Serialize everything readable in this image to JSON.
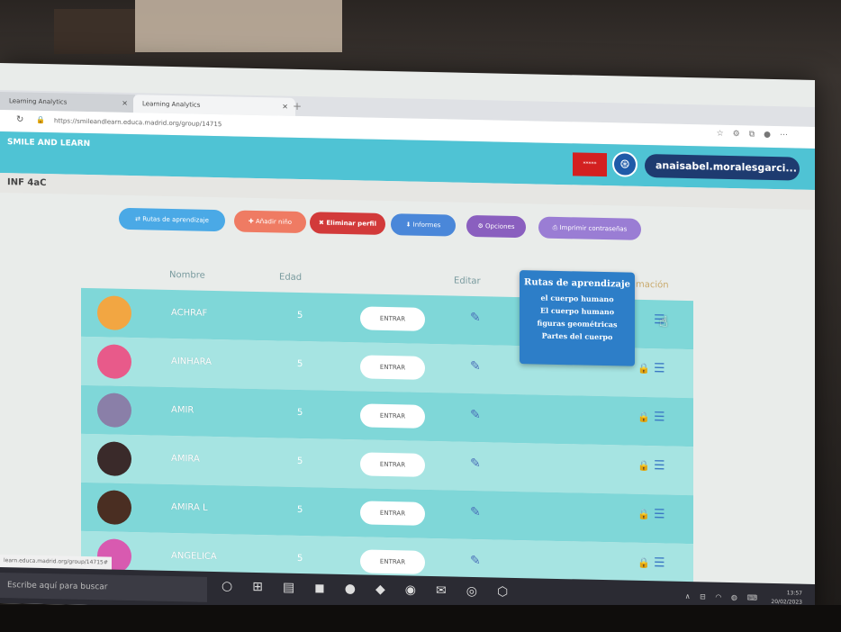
{
  "browser": {
    "tabs": [
      {
        "label": "Learning Analytics",
        "close": "×"
      },
      {
        "label": "Learning Analytics",
        "close": "×"
      }
    ],
    "new_tab": "+",
    "url": "https://smileandlearn.educa.madrid.org/group/14715",
    "status_url": "learn.educa.madrid.org/group/14715#"
  },
  "header": {
    "logo": "SMILE AND LEARN",
    "user": "anaisabel.moralesgarci...",
    "flag_label": "*****"
  },
  "breadcrumb": "INF 4aC",
  "actions": [
    {
      "label": "Rutas de aprendizaje",
      "icon": "route-icon"
    },
    {
      "label": "Añadir niño",
      "icon": "add-child-icon"
    },
    {
      "label": "Eliminar perfil",
      "icon": "close-icon"
    },
    {
      "label": "Informes",
      "icon": "download-icon"
    },
    {
      "label": "Opciones",
      "icon": "gear-icon"
    },
    {
      "label": "Imprimir contraseñas",
      "icon": "print-icon"
    }
  ],
  "table": {
    "headers": {
      "nombre": "Nombre",
      "edad": "Edad",
      "editar": "Editar",
      "info": "mación"
    },
    "enter_label": "ENTRAR",
    "rows": [
      {
        "name": "ACHRAF",
        "age": "5",
        "avatar_color": "#f2a642"
      },
      {
        "name": "AINHARA",
        "age": "5",
        "avatar_color": "#e85a8a"
      },
      {
        "name": "AMIR",
        "age": "5",
        "avatar_color": "#8a7fa8"
      },
      {
        "name": "AMIRA",
        "age": "5",
        "avatar_color": "#3a2a2a"
      },
      {
        "name": "AMIRA L",
        "age": "5",
        "avatar_color": "#4a2e22"
      },
      {
        "name": "ANGELICA",
        "age": "5",
        "avatar_color": "#d85ab0"
      }
    ]
  },
  "tooltip": {
    "title": "Rutas de aprendizaje",
    "items": [
      "el cuerpo humano",
      "El cuerpo humano",
      "figuras geométricas",
      "Partes del cuerpo"
    ]
  },
  "taskbar": {
    "search_placeholder": "Escribe aquí para buscar",
    "time": "13:57",
    "date": "20/02/2023"
  },
  "colors": {
    "header": "#4fc3d4",
    "row_odd": "#7fd7d8",
    "row_even": "#a6e4e2",
    "user_pill": "#1e3b70",
    "tooltip": "#2d7ec8"
  }
}
